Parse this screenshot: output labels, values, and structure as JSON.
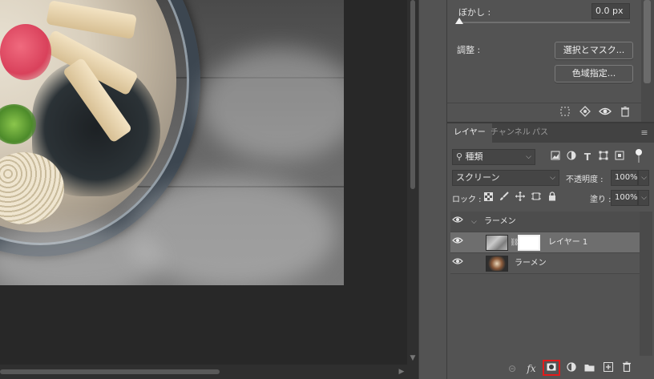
{
  "properties": {
    "feather_label": "ぼかし :",
    "feather_value": "0.0 px",
    "refine_label": "調整 :",
    "select_mask_button": "選択とマスク...",
    "color_range_button": "色域指定...",
    "footer_icons": [
      "selection-icon",
      "apply-mask-icon",
      "visibility-icon",
      "trash-icon"
    ]
  },
  "layers_panel": {
    "tabs": [
      {
        "label": "レイヤー",
        "active": true
      },
      {
        "label": "チャンネル",
        "active": false
      },
      {
        "label": "パス",
        "active": false
      }
    ],
    "filter_kind": "種類",
    "blend_mode": "スクリーン",
    "opacity_label": "不透明度 :",
    "opacity_value": "100%",
    "lock_label": "ロック :",
    "fill_label": "塗り :",
    "fill_value": "100%",
    "layers": [
      {
        "name": "ラーメン",
        "type": "group",
        "visible": true
      },
      {
        "name": "レイヤー 1",
        "type": "layer-with-mask",
        "visible": true,
        "selected": true
      },
      {
        "name": "ラーメン",
        "type": "image-layer",
        "visible": true
      }
    ],
    "footer_icons": [
      "link-icon",
      "fx-icon",
      "add-mask-icon",
      "adjustment-icon",
      "new-group-icon",
      "new-layer-icon",
      "trash-icon"
    ]
  },
  "colors": {
    "panel_bg": "#535353",
    "canvas_bg": "#282828",
    "highlight": "#e21b1b"
  }
}
